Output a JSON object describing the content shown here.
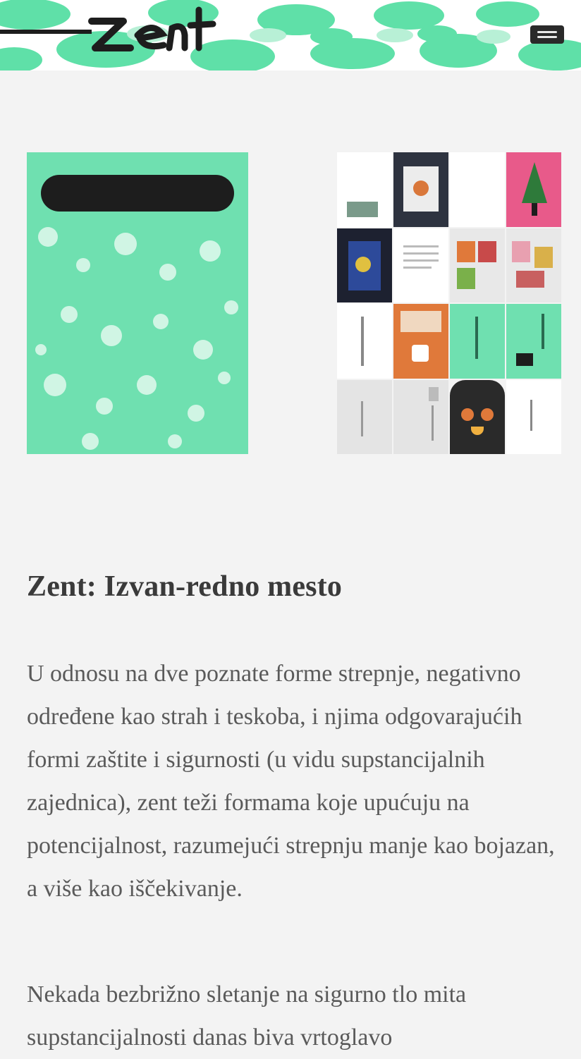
{
  "header": {
    "logo_alt": "zent",
    "menu_icon": "hamburger-menu-icon"
  },
  "hero": {
    "cover_icon": "book-cover-image",
    "collage_icon": "book-pages-collage-image"
  },
  "article": {
    "title": "Zent: Izvan-redno mesto",
    "paragraphs": [
      "U odnosu na dve poznate forme strepnje, negativno određene kao strah i teskoba, i njima odgovarajućih formi zaštite i sigurnosti (u vidu supstancijalnih zajednica), zent teži formama koje upućuju na potencijalnost, razumejući strepnju manje kao bojazan, a više kao iščekivanje.",
      "Nekada bezbrižno sletanje na sigurno tlo mita supstancijalnosti danas biva vrtoglavo"
    ]
  },
  "colors": {
    "background": "#f3f3f3",
    "accent_green": "#6fe0b0",
    "dark": "#1d1d1d",
    "pink": "#e85a8a",
    "orange": "#e0793a"
  }
}
